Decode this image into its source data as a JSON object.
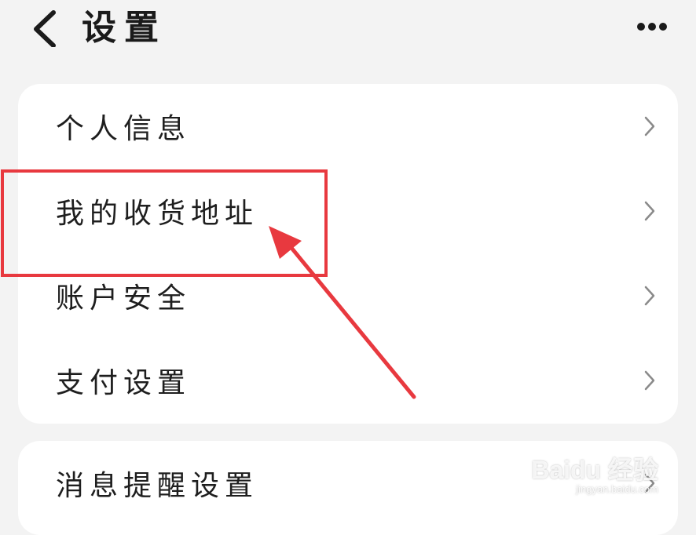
{
  "header": {
    "title": "设置",
    "back_icon": "chevron-left-icon",
    "more_icon": "more-horizontal-icon"
  },
  "settings_group_1": {
    "items": [
      {
        "label": "个人信息"
      },
      {
        "label": "我的收货地址"
      },
      {
        "label": "账户安全"
      },
      {
        "label": "支付设置"
      }
    ]
  },
  "settings_group_2": {
    "items": [
      {
        "label": "消息提醒设置"
      }
    ]
  },
  "annotation": {
    "color": "#e8393f"
  },
  "watermark": {
    "logo": "Baidu 经验",
    "url": "jingyan.baidu.com"
  }
}
